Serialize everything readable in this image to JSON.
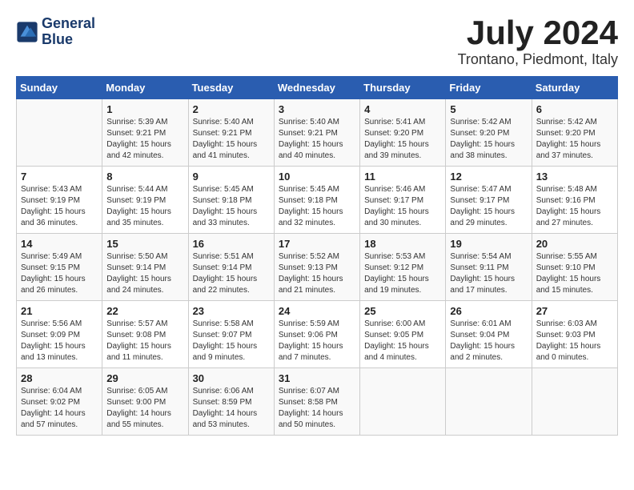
{
  "header": {
    "logo_line1": "General",
    "logo_line2": "Blue",
    "month_year": "July 2024",
    "location": "Trontano, Piedmont, Italy"
  },
  "columns": [
    "Sunday",
    "Monday",
    "Tuesday",
    "Wednesday",
    "Thursday",
    "Friday",
    "Saturday"
  ],
  "weeks": [
    [
      {
        "day": "",
        "info": ""
      },
      {
        "day": "1",
        "info": "Sunrise: 5:39 AM\nSunset: 9:21 PM\nDaylight: 15 hours\nand 42 minutes."
      },
      {
        "day": "2",
        "info": "Sunrise: 5:40 AM\nSunset: 9:21 PM\nDaylight: 15 hours\nand 41 minutes."
      },
      {
        "day": "3",
        "info": "Sunrise: 5:40 AM\nSunset: 9:21 PM\nDaylight: 15 hours\nand 40 minutes."
      },
      {
        "day": "4",
        "info": "Sunrise: 5:41 AM\nSunset: 9:20 PM\nDaylight: 15 hours\nand 39 minutes."
      },
      {
        "day": "5",
        "info": "Sunrise: 5:42 AM\nSunset: 9:20 PM\nDaylight: 15 hours\nand 38 minutes."
      },
      {
        "day": "6",
        "info": "Sunrise: 5:42 AM\nSunset: 9:20 PM\nDaylight: 15 hours\nand 37 minutes."
      }
    ],
    [
      {
        "day": "7",
        "info": "Sunrise: 5:43 AM\nSunset: 9:19 PM\nDaylight: 15 hours\nand 36 minutes."
      },
      {
        "day": "8",
        "info": "Sunrise: 5:44 AM\nSunset: 9:19 PM\nDaylight: 15 hours\nand 35 minutes."
      },
      {
        "day": "9",
        "info": "Sunrise: 5:45 AM\nSunset: 9:18 PM\nDaylight: 15 hours\nand 33 minutes."
      },
      {
        "day": "10",
        "info": "Sunrise: 5:45 AM\nSunset: 9:18 PM\nDaylight: 15 hours\nand 32 minutes."
      },
      {
        "day": "11",
        "info": "Sunrise: 5:46 AM\nSunset: 9:17 PM\nDaylight: 15 hours\nand 30 minutes."
      },
      {
        "day": "12",
        "info": "Sunrise: 5:47 AM\nSunset: 9:17 PM\nDaylight: 15 hours\nand 29 minutes."
      },
      {
        "day": "13",
        "info": "Sunrise: 5:48 AM\nSunset: 9:16 PM\nDaylight: 15 hours\nand 27 minutes."
      }
    ],
    [
      {
        "day": "14",
        "info": "Sunrise: 5:49 AM\nSunset: 9:15 PM\nDaylight: 15 hours\nand 26 minutes."
      },
      {
        "day": "15",
        "info": "Sunrise: 5:50 AM\nSunset: 9:14 PM\nDaylight: 15 hours\nand 24 minutes."
      },
      {
        "day": "16",
        "info": "Sunrise: 5:51 AM\nSunset: 9:14 PM\nDaylight: 15 hours\nand 22 minutes."
      },
      {
        "day": "17",
        "info": "Sunrise: 5:52 AM\nSunset: 9:13 PM\nDaylight: 15 hours\nand 21 minutes."
      },
      {
        "day": "18",
        "info": "Sunrise: 5:53 AM\nSunset: 9:12 PM\nDaylight: 15 hours\nand 19 minutes."
      },
      {
        "day": "19",
        "info": "Sunrise: 5:54 AM\nSunset: 9:11 PM\nDaylight: 15 hours\nand 17 minutes."
      },
      {
        "day": "20",
        "info": "Sunrise: 5:55 AM\nSunset: 9:10 PM\nDaylight: 15 hours\nand 15 minutes."
      }
    ],
    [
      {
        "day": "21",
        "info": "Sunrise: 5:56 AM\nSunset: 9:09 PM\nDaylight: 15 hours\nand 13 minutes."
      },
      {
        "day": "22",
        "info": "Sunrise: 5:57 AM\nSunset: 9:08 PM\nDaylight: 15 hours\nand 11 minutes."
      },
      {
        "day": "23",
        "info": "Sunrise: 5:58 AM\nSunset: 9:07 PM\nDaylight: 15 hours\nand 9 minutes."
      },
      {
        "day": "24",
        "info": "Sunrise: 5:59 AM\nSunset: 9:06 PM\nDaylight: 15 hours\nand 7 minutes."
      },
      {
        "day": "25",
        "info": "Sunrise: 6:00 AM\nSunset: 9:05 PM\nDaylight: 15 hours\nand 4 minutes."
      },
      {
        "day": "26",
        "info": "Sunrise: 6:01 AM\nSunset: 9:04 PM\nDaylight: 15 hours\nand 2 minutes."
      },
      {
        "day": "27",
        "info": "Sunrise: 6:03 AM\nSunset: 9:03 PM\nDaylight: 15 hours\nand 0 minutes."
      }
    ],
    [
      {
        "day": "28",
        "info": "Sunrise: 6:04 AM\nSunset: 9:02 PM\nDaylight: 14 hours\nand 57 minutes."
      },
      {
        "day": "29",
        "info": "Sunrise: 6:05 AM\nSunset: 9:00 PM\nDaylight: 14 hours\nand 55 minutes."
      },
      {
        "day": "30",
        "info": "Sunrise: 6:06 AM\nSunset: 8:59 PM\nDaylight: 14 hours\nand 53 minutes."
      },
      {
        "day": "31",
        "info": "Sunrise: 6:07 AM\nSunset: 8:58 PM\nDaylight: 14 hours\nand 50 minutes."
      },
      {
        "day": "",
        "info": ""
      },
      {
        "day": "",
        "info": ""
      },
      {
        "day": "",
        "info": ""
      }
    ]
  ]
}
